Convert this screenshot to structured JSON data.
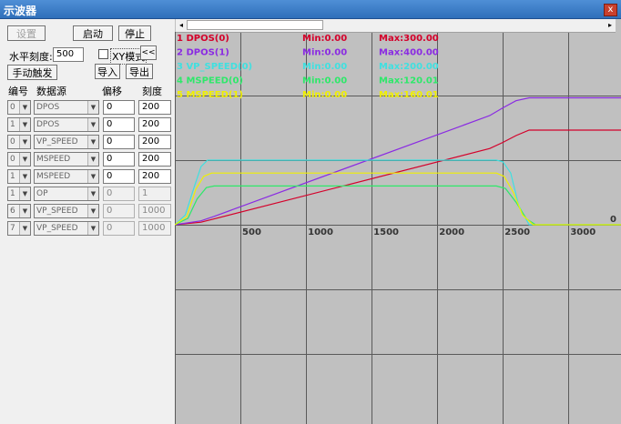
{
  "window": {
    "title": "示波器",
    "close": "x"
  },
  "controls": {
    "settings": "设置",
    "start": "启动",
    "stop": "停止",
    "hscale_label": "水平刻度:",
    "hscale_value": "500",
    "xy_mode": "XY模式",
    "xy_checked": false,
    "collapse": "<<",
    "manual_trigger": "手动触发",
    "import": "导入",
    "export": "导出"
  },
  "table": {
    "headers": [
      "编号",
      "数据源",
      "偏移",
      "刻度"
    ],
    "rows": [
      {
        "num": "0",
        "source": "DPOS",
        "offset": "0",
        "scale": "200",
        "enabled": true
      },
      {
        "num": "1",
        "source": "DPOS",
        "offset": "0",
        "scale": "200",
        "enabled": true
      },
      {
        "num": "0",
        "source": "VP_SPEED",
        "offset": "0",
        "scale": "200",
        "enabled": true
      },
      {
        "num": "0",
        "source": "MSPEED",
        "offset": "0",
        "scale": "200",
        "enabled": true
      },
      {
        "num": "1",
        "source": "MSPEED",
        "offset": "0",
        "scale": "200",
        "enabled": true
      },
      {
        "num": "1",
        "source": "OP",
        "offset": "0",
        "scale": "1",
        "enabled": false
      },
      {
        "num": "6",
        "source": "VP_SPEED",
        "offset": "0",
        "scale": "1000",
        "enabled": false
      },
      {
        "num": "7",
        "source": "VP_SPEED",
        "offset": "0",
        "scale": "1000",
        "enabled": false
      }
    ]
  },
  "scope": {
    "scroll_left": "◂",
    "scroll_right": "▸",
    "legend": [
      {
        "name": "1 DPOS(0)",
        "min": "Min:0.00",
        "max": "Max:300.00",
        "color": "#d4002a"
      },
      {
        "name": "2 DPOS(1)",
        "min": "Min:0.00",
        "max": "Max:400.00",
        "color": "#8a2be2"
      },
      {
        "name": "3 VP_SPEED(0)",
        "min": "Min:0.00",
        "max": "Max:200.00",
        "color": "#3fe0e0"
      },
      {
        "name": "4 MSPEED(0)",
        "min": "Min:0.00",
        "max": "Max:120.01",
        "color": "#2ee86a"
      },
      {
        "name": "5 MSPEED(1)",
        "min": "Min:0.00",
        "max": "Max:160.01",
        "color": "#f0f000"
      }
    ],
    "x_ticks": [
      "500",
      "1000",
      "1500",
      "2000",
      "2500",
      "3000"
    ],
    "zero_label": "0"
  },
  "chart_data": {
    "type": "line",
    "xlim": [
      0,
      3400
    ],
    "ylim": [
      -400,
      400
    ],
    "x_ticks": [
      500,
      1000,
      1500,
      2000,
      2500,
      3000
    ],
    "grid": true,
    "series": [
      {
        "name": "1 DPOS(0)",
        "color": "#d4002a",
        "x": [
          0,
          200,
          300,
          2400,
          2500,
          2600,
          2700,
          3400
        ],
        "y": [
          0,
          8,
          18,
          236,
          255,
          276,
          293,
          293
        ]
      },
      {
        "name": "2 DPOS(1)",
        "color": "#8a2be2",
        "x": [
          0,
          200,
          300,
          2400,
          2500,
          2600,
          2700,
          3400
        ],
        "y": [
          0,
          12,
          26,
          338,
          362,
          384,
          393,
          393
        ]
      },
      {
        "name": "3 VP_SPEED(0)",
        "color": "#3fe0e0",
        "x": [
          0,
          80,
          150,
          200,
          250,
          2450,
          2500,
          2560,
          2620,
          2700,
          3400
        ],
        "y": [
          0,
          30,
          120,
          180,
          200,
          200,
          195,
          160,
          60,
          0,
          0
        ]
      },
      {
        "name": "4 MSPEED(0)",
        "color": "#2ee86a",
        "x": [
          0,
          100,
          170,
          240,
          300,
          2450,
          2520,
          2600,
          2680,
          2750,
          3400
        ],
        "y": [
          0,
          20,
          80,
          115,
          120,
          120,
          112,
          70,
          18,
          0,
          0
        ]
      },
      {
        "name": "5 MSPEED(1)",
        "color": "#f0f000",
        "x": [
          0,
          90,
          160,
          220,
          280,
          2450,
          2510,
          2580,
          2650,
          2730,
          3400
        ],
        "y": [
          0,
          25,
          110,
          150,
          160,
          160,
          150,
          100,
          30,
          0,
          0
        ]
      }
    ]
  }
}
